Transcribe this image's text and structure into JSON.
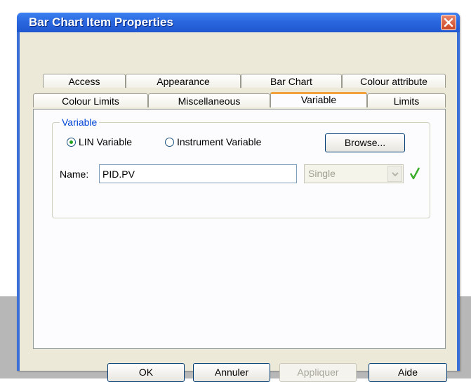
{
  "window": {
    "title": "Bar Chart Item Properties"
  },
  "tabs": {
    "row1": [
      "Access",
      "Appearance",
      "Bar Chart",
      "Colour attribute"
    ],
    "row2": [
      "Colour Limits",
      "Miscellaneous",
      "Variable",
      "Limits"
    ],
    "active": "Variable"
  },
  "variable": {
    "group_label": "Variable",
    "radio_lin": "LIN Variable",
    "radio_instrument": "Instrument Variable",
    "selected": "LIN Variable",
    "browse_label": "Browse...",
    "name_label": "Name:",
    "name_value": "PID.PV",
    "mode_value": "Single"
  },
  "buttons": {
    "ok": "OK",
    "cancel": "Annuler",
    "apply": "Appliquer",
    "help": "Aide"
  },
  "colors": {
    "title_bar": "#2a67df",
    "active_tab_accent": "#f3a13c",
    "radio_dot": "#21a121",
    "check": "#3aae2a"
  }
}
